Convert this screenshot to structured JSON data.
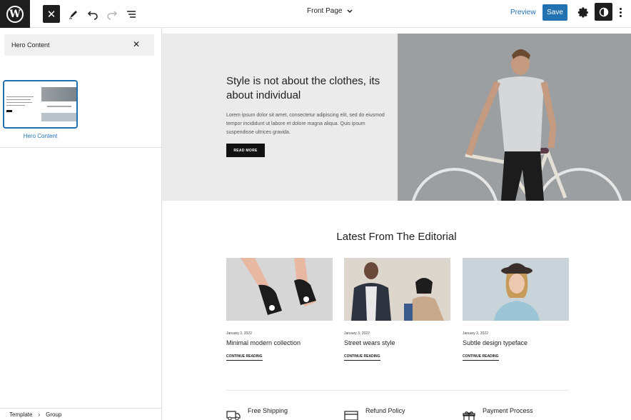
{
  "header": {
    "doc_title": "Front Page",
    "preview_label": "Preview",
    "save_label": "Save"
  },
  "sidebar": {
    "search_value": "Hero Content",
    "pattern_label": "Hero Content",
    "breadcrumb": [
      "Template",
      "Group"
    ]
  },
  "hero": {
    "title": "Style is not about the clothes, its about individual",
    "body": "Lorem ipsum dolor sit amet, consectetur adipiscing elit, sed do eiusmod tempor incididunt ut labore et dolore magna aliqua. Quis ipsum suspendisse ultrices gravida.",
    "button_label": "READ MORE"
  },
  "editorial": {
    "title": "Latest From The Editorial",
    "posts": [
      {
        "date": "January 3, 2022",
        "title": "Minimal modern collection",
        "link": "CONTINUE READING"
      },
      {
        "date": "January 3, 2022",
        "title": "Street wears style",
        "link": "CONTINUE READING"
      },
      {
        "date": "January 3, 2022",
        "title": "Subtle design typeface",
        "link": "CONTINUE READING"
      }
    ]
  },
  "features": [
    "Free Shipping",
    "Refund Policy",
    "Payment Process"
  ],
  "colors": {
    "accent": "#2271b1",
    "dark": "#1e1e1e"
  }
}
